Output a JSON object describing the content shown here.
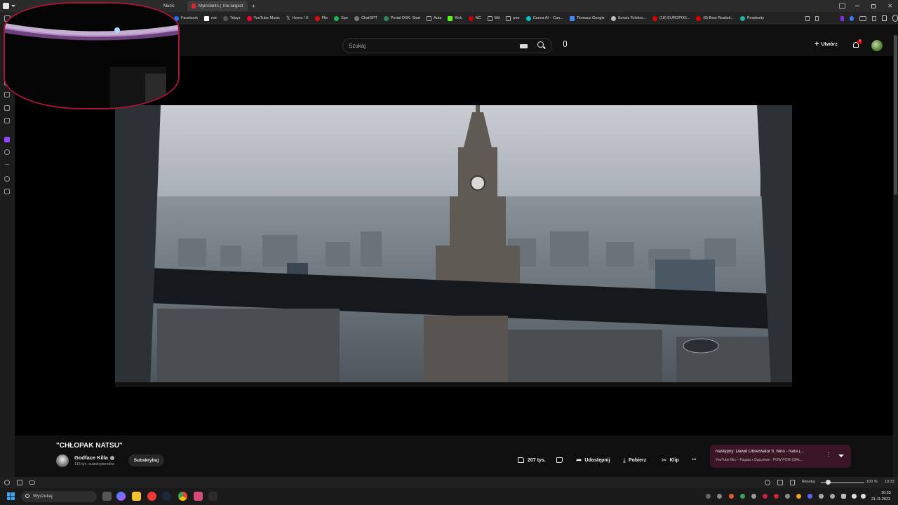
{
  "browser": {
    "tabs": [
      {
        "label": "Music"
      },
      {
        "label": "Myinstants | The largest in"
      }
    ],
    "bookmarks": [
      {
        "label": "Facebook",
        "color": "#1877f2"
      },
      {
        "label": "net",
        "color": "#ffffff"
      },
      {
        "label": "7days",
        "color": "#444444"
      },
      {
        "label": "YouTube Music",
        "color": "#ff0033"
      },
      {
        "label": "Home / X",
        "color": "#000000"
      },
      {
        "label": "Flix",
        "color": "#e50914"
      },
      {
        "label": "Spo",
        "color": "#1db954"
      },
      {
        "label": "ChatGPT",
        "color": "#6b6b6b"
      },
      {
        "label": "Portal OSK: Start",
        "color": "#2e8b57"
      },
      {
        "label": "Auta",
        "color": "#888888"
      },
      {
        "label": "Kick",
        "color": "#53fc18"
      },
      {
        "label": "NC",
        "color": "#cc0000"
      },
      {
        "label": "Mtt",
        "color": "#888888"
      },
      {
        "label": "poe",
        "color": "#888888"
      },
      {
        "label": "Canva AI – Can...",
        "color": "#00c4cc"
      },
      {
        "label": "Tłumacz Google",
        "color": "#4285f4"
      },
      {
        "label": "Serwis Telefon...",
        "color": "#bbbbbb"
      },
      {
        "label": "(18) EUROPOS...",
        "color": "#e00000"
      },
      {
        "label": "(8) Best Realisti...",
        "color": "#e00000"
      },
      {
        "label": "Perplexity",
        "color": "#20b2aa"
      }
    ]
  },
  "youtube": {
    "search": {
      "placeholder": "Szukaj"
    },
    "create_label": "Utwórz",
    "notif_count": "4",
    "video": {
      "title": "\"CHŁOPAK NATSU\"",
      "channel": "Godface Killa",
      "subscribers": "115 tys. subskrybentów",
      "subscribe_label": "Subskrybuj",
      "likes": "207 tys.",
      "share_label": "Udostępnij",
      "download_label": "Pobierz",
      "clip_label": "Klip",
      "more_label": "•••"
    },
    "next_up": {
      "title": "Następny: Dawid Obserwator ft. Nino - Nara (...",
      "subtitle": "YouTube Mix – Fagata x Dajczman - POW POW (Offic..."
    }
  },
  "status": {
    "reset_label": "Resetuj",
    "zoom": "100 %",
    "time_small": "10:33"
  },
  "taskbar": {
    "search_placeholder": "Wyszukaj",
    "time": "10:33",
    "date": "21.11.2023"
  },
  "colors": {
    "accent": "#a8153a",
    "yt_red": "#ff0033"
  }
}
